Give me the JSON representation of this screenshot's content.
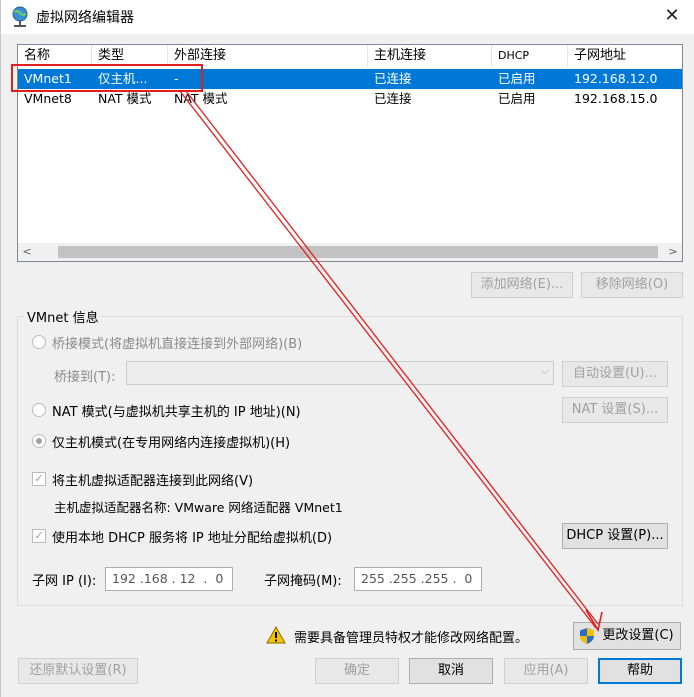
{
  "window": {
    "title": "虚拟网络编辑器",
    "close_glyph": "✕"
  },
  "table": {
    "columns": [
      "名称",
      "类型",
      "外部连接",
      "主机连接",
      "DHCP",
      "子网地址"
    ],
    "rows": [
      {
        "name": "VMnet1",
        "type": "仅主机...",
        "external": "-",
        "host": "已连接",
        "dhcp": "已启用",
        "subnet": "192.168.12.0",
        "selected": true
      },
      {
        "name": "VMnet8",
        "type": "NAT 模式",
        "external": "NAT 模式",
        "host": "已连接",
        "dhcp": "已启用",
        "subnet": "192.168.15.0",
        "selected": false
      }
    ],
    "scroll_left": "<",
    "scroll_right": ">"
  },
  "list_buttons": {
    "add": "添加网络(E)...",
    "remove": "移除网络(O)"
  },
  "vmnet_info": {
    "group_title": "VMnet 信息",
    "bridged_label": "桥接模式(将虚拟机直接连接到外部网络)(B)",
    "bridge_to_label": "桥接到(T):",
    "bridge_to_value": "",
    "auto_settings": "自动设置(U)...",
    "nat_label": "NAT 模式(与虚拟机共享主机的 IP 地址)(N)",
    "nat_settings": "NAT 设置(S)...",
    "hostonly_label": "仅主机模式(在专用网络内连接虚拟机)(H)",
    "selected_mode": "hostonly",
    "connect_adapter_label": "将主机虚拟适配器连接到此网络(V)",
    "adapter_name": "主机虚拟适配器名称: VMware 网络适配器 VMnet1",
    "dhcp_label": "使用本地 DHCP 服务将 IP 地址分配给虚拟机(D)",
    "dhcp_settings": "DHCP 设置(P)...",
    "subnet_ip_label": "子网 IP (I):",
    "subnet_ip": "192 .168 . 12  .  0",
    "subnet_mask_label": "子网掩码(M):",
    "subnet_mask": "255 .255 .255 .  0"
  },
  "admin_notice": "需要具备管理员特权才能修改网络配置。",
  "change_settings": "更改设置(C)",
  "footer": {
    "restore": "还原默认设置(R)",
    "ok": "确定",
    "cancel": "取消",
    "apply": "应用(A)",
    "help": "帮助"
  },
  "colors": {
    "selection": "#0078d7",
    "annotation": "#e02020",
    "dialog_bg": "#f0f0f0"
  }
}
